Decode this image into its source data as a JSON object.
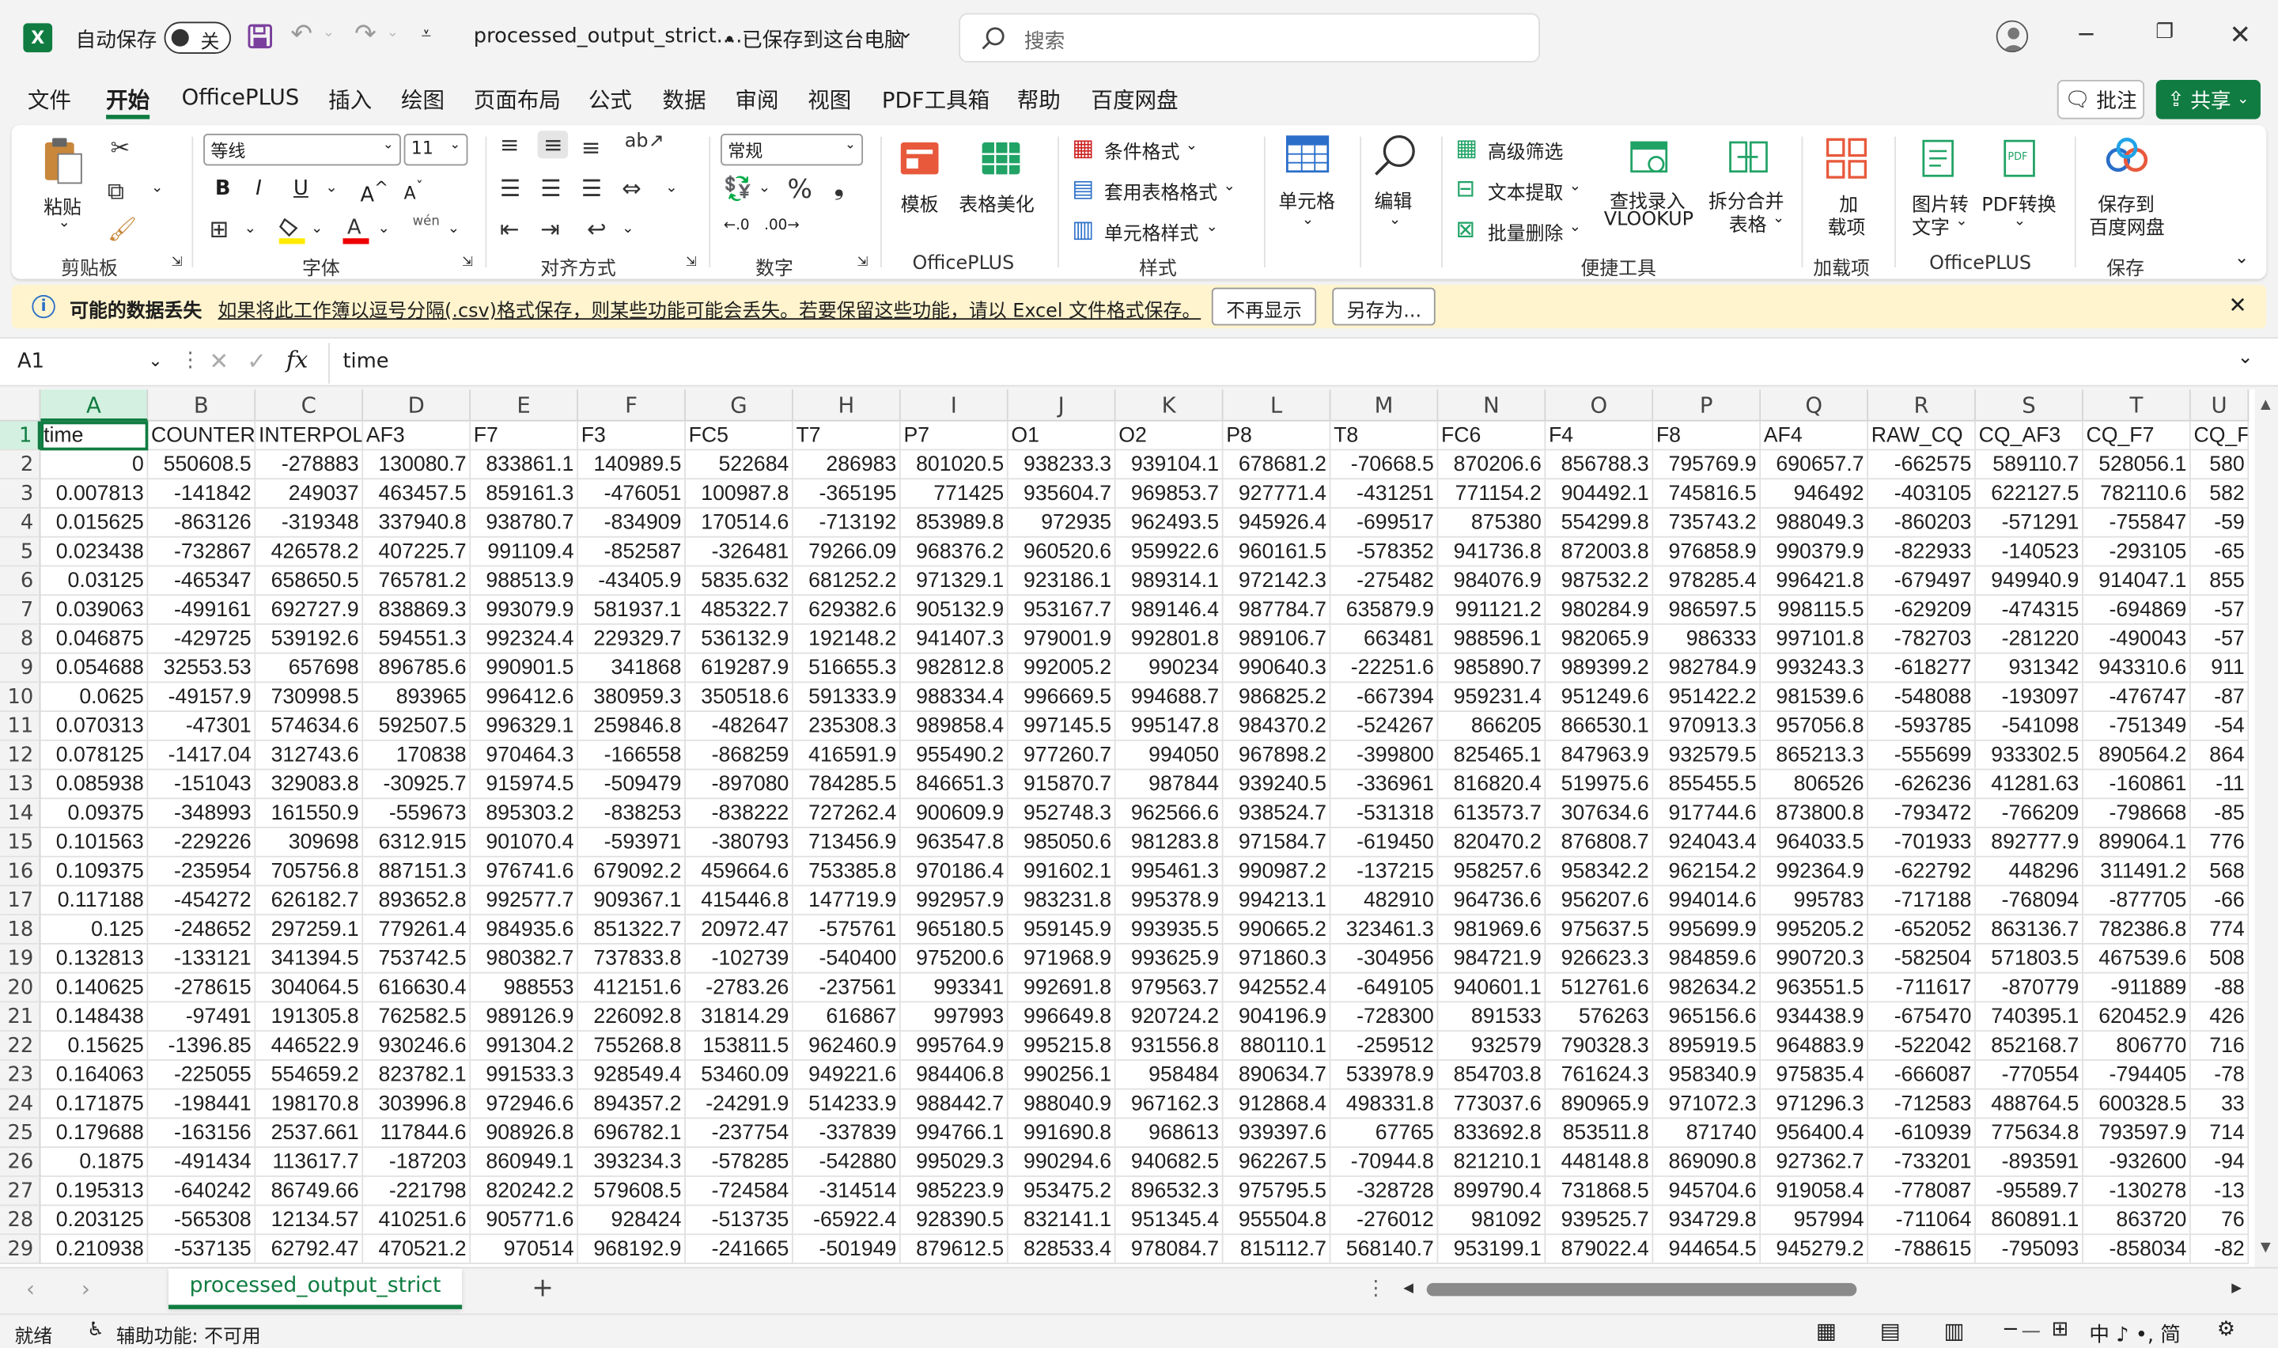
{
  "title_bar": {
    "app_icon": "excel-logo",
    "app_icon_letter": "X",
    "autosave_label": "自动保存",
    "autosave_state": "关",
    "file_name": "processed_output_strict....",
    "save_status": "• 已保存到这台电脑",
    "search_placeholder": "搜索"
  },
  "menu_tabs": [
    "文件",
    "开始",
    "OfficePLUS",
    "插入",
    "绘图",
    "页面布局",
    "公式",
    "数据",
    "审阅",
    "视图",
    "PDF工具箱",
    "帮助",
    "百度网盘"
  ],
  "active_tab": "开始",
  "comments_button": "批注",
  "share_button": "共享",
  "ribbon": {
    "clipboard": {
      "paste": "粘贴",
      "group": "剪贴板"
    },
    "font": {
      "name": "等线",
      "size": "11",
      "group": "字体",
      "phonetic": "wén"
    },
    "alignment": {
      "group": "对齐方式"
    },
    "number": {
      "format": "常规",
      "group": "数字"
    },
    "officeplus": {
      "template": "模板",
      "beautify": "表格美化",
      "group": "OfficePLUS"
    },
    "styles": {
      "conditional": "条件格式",
      "table": "套用表格格式",
      "cell": "单元格样式",
      "group": "样式"
    },
    "cells": {
      "label": "单元格"
    },
    "editing": {
      "label": "编辑"
    },
    "tools": {
      "filter": "高级筛选",
      "extract": "文本提取",
      "batch_delete": "批量删除",
      "vlookup": "查找录入\nVLOOKUP",
      "vlookup_1": "查找录入",
      "vlookup_2": "VLOOKUP",
      "split_1": "拆分合并",
      "split_2": "表格",
      "group": "便捷工具"
    },
    "addins": {
      "label_1": "加",
      "label_2": "载项",
      "group": "加载项"
    },
    "officeplus2": {
      "img2text_1": "图片转",
      "img2text_2": "文字",
      "pdf": "PDF转换",
      "group": "OfficePLUS"
    },
    "save": {
      "label_1": "保存到",
      "label_2": "百度网盘",
      "group": "保存"
    }
  },
  "infobar": {
    "title": "可能的数据丢失",
    "message": "如果将此工作簿以逗号分隔(.csv)格式保存，则某些功能可能会丢失。若要保留这些功能，请以 Excel 文件格式保存。",
    "btn_dismiss": "不再显示",
    "btn_saveas": "另存为..."
  },
  "formula_bar": {
    "name_box": "A1",
    "fx": "fx",
    "content": "time"
  },
  "columns": [
    "A",
    "B",
    "C",
    "D",
    "E",
    "F",
    "G",
    "H",
    "I",
    "J",
    "K",
    "L",
    "M",
    "N",
    "O",
    "P",
    "Q",
    "R",
    "S",
    "T",
    "U"
  ],
  "rows": [
    [
      "time",
      "COUNTER",
      "INTERPOL",
      "AF3",
      "F7",
      "F3",
      "FC5",
      "T7",
      "P7",
      "O1",
      "O2",
      "P8",
      "T8",
      "FC6",
      "F4",
      "F8",
      "AF4",
      "RAW_CQ",
      "CQ_AF3",
      "CQ_F7",
      "CQ_F"
    ],
    [
      "0",
      "550608.5",
      "-278883",
      "130080.7",
      "833861.1",
      "140989.5",
      "522684",
      "286983",
      "801020.5",
      "938233.3",
      "939104.1",
      "678681.2",
      "-70668.5",
      "870206.6",
      "856788.3",
      "795769.9",
      "690657.7",
      "-662575",
      "589110.7",
      "528056.1",
      "580"
    ],
    [
      "0.007813",
      "-141842",
      "249037",
      "463457.5",
      "859161.3",
      "-476051",
      "100987.8",
      "-365195",
      "771425",
      "935604.7",
      "969853.7",
      "927771.4",
      "-431251",
      "771154.2",
      "904492.1",
      "745816.5",
      "946492",
      "-403105",
      "622127.5",
      "782110.6",
      "582"
    ],
    [
      "0.015625",
      "-863126",
      "-319348",
      "337940.8",
      "938780.7",
      "-834909",
      "170514.6",
      "-713192",
      "853989.8",
      "972935",
      "962493.5",
      "945926.4",
      "-699517",
      "875380",
      "554299.8",
      "735743.2",
      "988049.3",
      "-860203",
      "-571291",
      "-755847",
      "-59"
    ],
    [
      "0.023438",
      "-732867",
      "426578.2",
      "407225.7",
      "991109.4",
      "-852587",
      "-326481",
      "79266.09",
      "968376.2",
      "960520.6",
      "959922.6",
      "960161.5",
      "-578352",
      "941736.8",
      "872003.8",
      "976858.9",
      "990379.9",
      "-822933",
      "-140523",
      "-293105",
      "-65"
    ],
    [
      "0.03125",
      "-465347",
      "658650.5",
      "765781.2",
      "988513.9",
      "-43405.9",
      "5835.632",
      "681252.2",
      "971329.1",
      "923186.1",
      "989314.1",
      "972142.3",
      "-275482",
      "984076.9",
      "987532.2",
      "978285.4",
      "996421.8",
      "-679497",
      "949940.9",
      "914047.1",
      "855"
    ],
    [
      "0.039063",
      "-499161",
      "692727.9",
      "838869.3",
      "993079.9",
      "581937.1",
      "485322.7",
      "629382.6",
      "905132.9",
      "953167.7",
      "989146.4",
      "987784.7",
      "635879.9",
      "991121.2",
      "980284.9",
      "986597.5",
      "998115.5",
      "-629209",
      "-474315",
      "-694869",
      "-57"
    ],
    [
      "0.046875",
      "-429725",
      "539192.6",
      "594551.3",
      "992324.4",
      "229329.7",
      "536132.9",
      "192148.2",
      "941407.3",
      "979001.9",
      "992801.8",
      "989106.7",
      "663481",
      "988596.1",
      "982065.9",
      "986333",
      "997101.8",
      "-782703",
      "-281220",
      "-490043",
      "-57"
    ],
    [
      "0.054688",
      "32553.53",
      "657698",
      "896785.6",
      "990901.5",
      "341868",
      "619287.9",
      "516655.3",
      "982812.8",
      "992005.2",
      "990234",
      "990640.3",
      "-22251.6",
      "985890.7",
      "989399.2",
      "982784.9",
      "993243.3",
      "-618277",
      "931342",
      "943310.6",
      "911"
    ],
    [
      "0.0625",
      "-49157.9",
      "730998.5",
      "893965",
      "996412.6",
      "380959.3",
      "350518.6",
      "591333.9",
      "988334.4",
      "996669.5",
      "994688.7",
      "986825.2",
      "-667394",
      "959231.4",
      "951249.6",
      "951422.2",
      "981539.6",
      "-548088",
      "-193097",
      "-476747",
      "-87"
    ],
    [
      "0.070313",
      "-47301",
      "574634.6",
      "592507.5",
      "996329.1",
      "259846.8",
      "-482647",
      "235308.3",
      "989858.4",
      "997145.5",
      "995147.8",
      "984370.2",
      "-524267",
      "866205",
      "866530.1",
      "970913.3",
      "957056.8",
      "-593785",
      "-541098",
      "-751349",
      "-54"
    ],
    [
      "0.078125",
      "-1417.04",
      "312743.6",
      "170838",
      "970464.3",
      "-166558",
      "-868259",
      "416591.9",
      "955490.2",
      "977260.7",
      "994050",
      "967898.2",
      "-399800",
      "825465.1",
      "847963.9",
      "932579.5",
      "865213.3",
      "-555699",
      "933302.5",
      "890564.2",
      "864"
    ],
    [
      "0.085938",
      "-151043",
      "329083.8",
      "-30925.7",
      "915974.5",
      "-509479",
      "-897080",
      "784285.5",
      "846651.3",
      "915870.7",
      "987844",
      "939240.5",
      "-336961",
      "816820.4",
      "519975.6",
      "855455.5",
      "806526",
      "-626236",
      "41281.63",
      "-160861",
      "-11"
    ],
    [
      "0.09375",
      "-348993",
      "161550.9",
      "-559673",
      "895303.2",
      "-838253",
      "-838222",
      "727262.4",
      "900609.9",
      "952748.3",
      "962566.6",
      "938524.7",
      "-531318",
      "613573.7",
      "307634.6",
      "917744.6",
      "873800.8",
      "-793472",
      "-766209",
      "-798668",
      "-85"
    ],
    [
      "0.101563",
      "-229226",
      "309698",
      "6312.915",
      "901070.4",
      "-593971",
      "-380793",
      "713456.9",
      "963547.8",
      "985050.6",
      "981283.8",
      "971584.7",
      "-619450",
      "820470.2",
      "876808.7",
      "924043.4",
      "964033.5",
      "-701933",
      "892777.9",
      "899064.1",
      "776"
    ],
    [
      "0.109375",
      "-235954",
      "705756.8",
      "887151.3",
      "976741.6",
      "679092.2",
      "459664.6",
      "753385.8",
      "970186.4",
      "991602.1",
      "995461.3",
      "990987.2",
      "-137215",
      "958257.6",
      "958342.2",
      "962154.2",
      "992364.9",
      "-622792",
      "448296",
      "311491.2",
      "568"
    ],
    [
      "0.117188",
      "-454272",
      "626182.7",
      "893652.8",
      "992577.7",
      "909367.1",
      "415446.8",
      "147719.9",
      "992957.9",
      "983231.8",
      "995378.9",
      "994213.1",
      "482910",
      "964736.6",
      "956207.6",
      "994014.6",
      "995783",
      "-717188",
      "-768094",
      "-877705",
      "-66"
    ],
    [
      "0.125",
      "-248652",
      "297259.1",
      "779261.4",
      "984935.6",
      "851322.7",
      "20972.47",
      "-575761",
      "965180.5",
      "959145.9",
      "993935.5",
      "990665.2",
      "323461.3",
      "981969.6",
      "975637.5",
      "995699.9",
      "995205.2",
      "-652052",
      "863136.7",
      "782386.8",
      "774"
    ],
    [
      "0.132813",
      "-133121",
      "341394.5",
      "753742.5",
      "980382.7",
      "737833.8",
      "-102739",
      "-540400",
      "975200.6",
      "971968.9",
      "993625.9",
      "971860.3",
      "-304956",
      "984721.9",
      "926623.3",
      "984859.6",
      "990720.3",
      "-582504",
      "571803.5",
      "467539.6",
      "508"
    ],
    [
      "0.140625",
      "-278615",
      "304064.5",
      "616630.4",
      "988553",
      "412151.6",
      "-2783.26",
      "-237561",
      "993341",
      "992691.8",
      "979563.7",
      "942552.4",
      "-649105",
      "940601.1",
      "512761.6",
      "982634.2",
      "963551.5",
      "-711617",
      "-870779",
      "-911889",
      "-88"
    ],
    [
      "0.148438",
      "-97491",
      "191305.8",
      "762582.5",
      "989126.9",
      "226092.8",
      "31814.29",
      "616867",
      "997993",
      "996649.8",
      "920724.2",
      "904196.9",
      "-728300",
      "891533",
      "576263",
      "965156.6",
      "934438.9",
      "-675470",
      "740395.1",
      "620452.9",
      "426"
    ],
    [
      "0.15625",
      "-1396.85",
      "446522.9",
      "930246.6",
      "991304.2",
      "755268.8",
      "153811.5",
      "962460.9",
      "995764.9",
      "995215.8",
      "931556.8",
      "880110.1",
      "-259512",
      "932579",
      "790328.3",
      "895919.5",
      "964883.9",
      "-522042",
      "852168.7",
      "806770",
      "716"
    ],
    [
      "0.164063",
      "-225055",
      "554659.2",
      "823782.1",
      "991533.3",
      "928549.4",
      "53460.09",
      "949221.6",
      "984406.8",
      "990256.1",
      "958484",
      "890634.7",
      "533978.9",
      "854703.8",
      "761624.3",
      "958340.9",
      "975835.4",
      "-666087",
      "-770554",
      "-794405",
      "-78"
    ],
    [
      "0.171875",
      "-198441",
      "198170.8",
      "303996.8",
      "972946.6",
      "894357.2",
      "-24291.9",
      "514233.9",
      "988442.7",
      "988040.9",
      "967162.3",
      "912868.4",
      "498331.8",
      "773037.6",
      "890965.9",
      "971072.3",
      "971296.3",
      "-712583",
      "488764.5",
      "600328.5",
      "33"
    ],
    [
      "0.179688",
      "-163156",
      "2537.661",
      "117844.6",
      "908926.8",
      "696782.1",
      "-237754",
      "-337839",
      "994766.1",
      "991690.8",
      "968613",
      "939397.6",
      "67765",
      "833692.8",
      "853511.8",
      "871740",
      "956400.4",
      "-610939",
      "775634.8",
      "793597.9",
      "714"
    ],
    [
      "0.1875",
      "-491434",
      "113617.7",
      "-187203",
      "860949.1",
      "393234.3",
      "-578285",
      "-542880",
      "995029.3",
      "990294.6",
      "940682.5",
      "962267.5",
      "-70944.8",
      "821210.1",
      "448148.8",
      "869090.8",
      "927362.7",
      "-733201",
      "-893591",
      "-932600",
      "-94"
    ],
    [
      "0.195313",
      "-640242",
      "86749.66",
      "-221798",
      "820242.2",
      "579608.5",
      "-724584",
      "-314514",
      "985223.9",
      "953475.2",
      "896532.3",
      "975795.5",
      "-328728",
      "899790.4",
      "731868.5",
      "945704.6",
      "919058.4",
      "-778087",
      "-95589.7",
      "-130278",
      "-13"
    ],
    [
      "0.203125",
      "-565308",
      "12134.57",
      "410251.6",
      "905771.6",
      "928424",
      "-513735",
      "-65922.4",
      "928390.5",
      "832141.1",
      "951345.4",
      "955504.8",
      "-276012",
      "981092",
      "939525.7",
      "934729.8",
      "957994",
      "-711064",
      "860891.1",
      "863720",
      "76"
    ],
    [
      "0.210938",
      "-537135",
      "62792.47",
      "470521.2",
      "970514",
      "968192.9",
      "-241665",
      "-501949",
      "879612.5",
      "828533.4",
      "978084.7",
      "815112.7",
      "568140.7",
      "953199.1",
      "879022.4",
      "944654.5",
      "945279.2",
      "-788615",
      "-795093",
      "-858034",
      "-82"
    ]
  ],
  "sheet_tab": "processed_output_strict",
  "status": {
    "ready": "就绪",
    "accessibility": "辅助功能: 不可用",
    "ime": "中 ♪ •, 简"
  }
}
